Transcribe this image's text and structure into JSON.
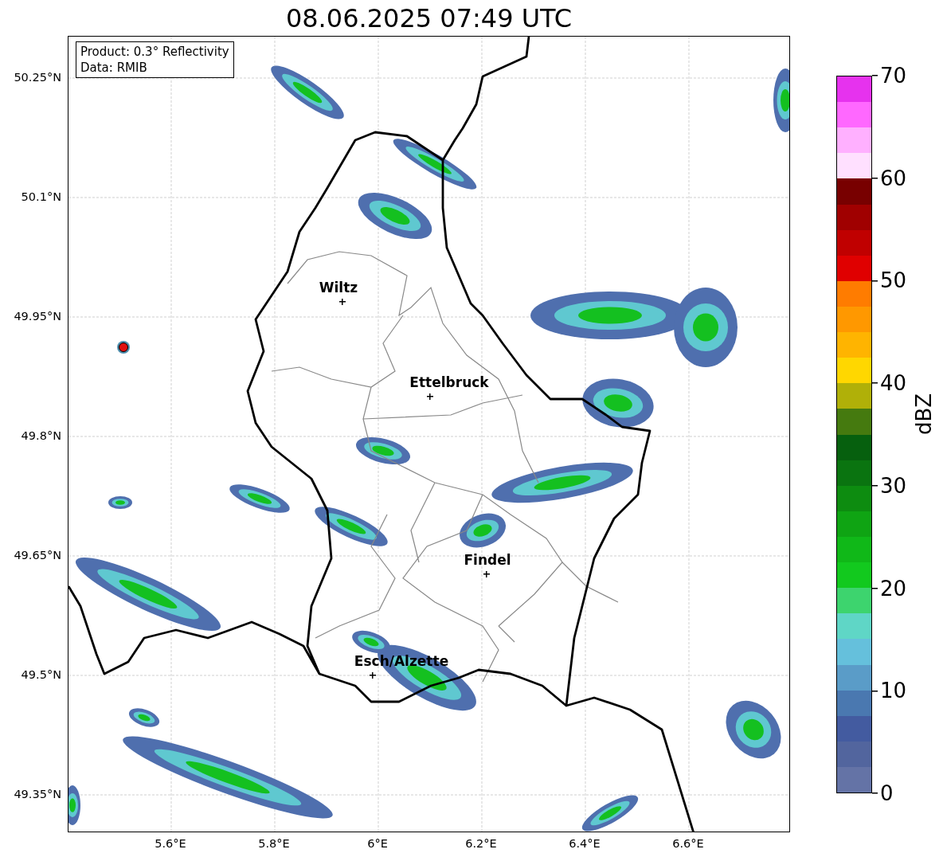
{
  "title": "08.06.2025 07:49 UTC",
  "info_box": [
    "Product: 0.3° Reflectivity",
    "Data: RMIB"
  ],
  "map": {
    "xticks": [
      "5.6°E",
      "5.8°E",
      "6°E",
      "6.2°E",
      "6.4°E",
      "6.6°E"
    ],
    "yticks": [
      "50.25°N",
      "50.1°N",
      "49.95°N",
      "49.8°N",
      "49.65°N",
      "49.5°N",
      "49.35°N"
    ],
    "cities": [
      {
        "name": "Wiltz"
      },
      {
        "name": "Ettelbruck"
      },
      {
        "name": "Findel"
      },
      {
        "name": "Esch/Alzette"
      }
    ]
  },
  "colorbar": {
    "label": "dBZ",
    "ticks": [
      "70",
      "60",
      "50",
      "40",
      "30",
      "20",
      "10",
      "0"
    ],
    "bins": [
      {
        "color": "#6473a6"
      },
      {
        "color": "#52659e"
      },
      {
        "color": "#435ba0"
      },
      {
        "color": "#4a78b0"
      },
      {
        "color": "#5a9cc8"
      },
      {
        "color": "#65c0dc"
      },
      {
        "color": "#5fd6c6"
      },
      {
        "color": "#3dd46e"
      },
      {
        "color": "#12c91e"
      },
      {
        "color": "#10b818"
      },
      {
        "color": "#0fa413"
      },
      {
        "color": "#0d8c10"
      },
      {
        "color": "#0a7410"
      },
      {
        "color": "#06600e"
      },
      {
        "color": "#457a0f"
      },
      {
        "color": "#b0b008"
      },
      {
        "color": "#ffd700"
      },
      {
        "color": "#ffb400"
      },
      {
        "color": "#ff9800"
      },
      {
        "color": "#ff7c00"
      },
      {
        "color": "#e00000"
      },
      {
        "color": "#c00000"
      },
      {
        "color": "#a00000"
      },
      {
        "color": "#780000"
      },
      {
        "color": "#ffe0ff"
      },
      {
        "color": "#ffb0ff"
      },
      {
        "color": "#ff68ff"
      },
      {
        "color": "#e632ee"
      }
    ]
  }
}
